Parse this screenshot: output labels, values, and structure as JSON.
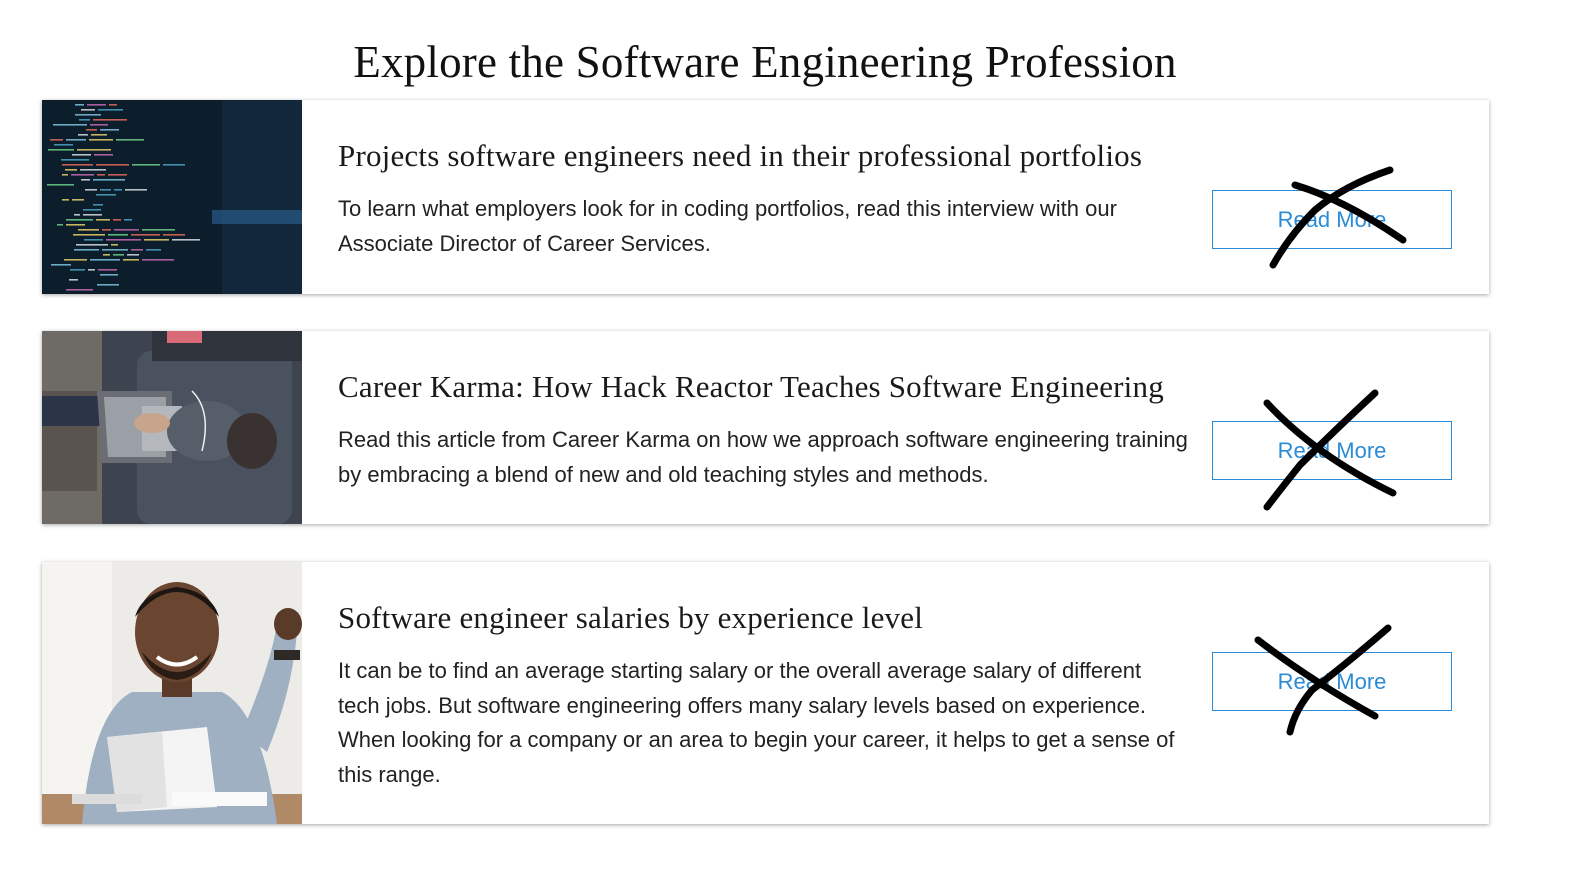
{
  "page": {
    "title": "Explore the Software Engineering Profession"
  },
  "articles": [
    {
      "title": "Projects software engineers need in their professional portfolios",
      "description": "To learn what employers look for in coding portfolios, read this interview with our Associate Director of Career Services.",
      "button_label": "Read More",
      "image": "code-editor-photo"
    },
    {
      "title": "Career Karma: How Hack Reactor Teaches Software Engineering",
      "description": "Read this article from Career Karma on how we approach software engineering training by embracing a blend of new and old teaching styles and methods.",
      "button_label": "Read More",
      "image": "person-with-laptop-photo"
    },
    {
      "title": "Software engineer salaries by experience level",
      "description": "It can be to find an average starting salary or the overall average salary of different tech jobs. But software engineering offers many salary levels based on experience. When looking for a company or an area to begin your career, it helps to get a sense of this range.",
      "button_label": "Read More",
      "image": "celebrating-man-photo"
    }
  ],
  "colors": {
    "accent": "#2a8bd6",
    "annotation": "#000000"
  }
}
